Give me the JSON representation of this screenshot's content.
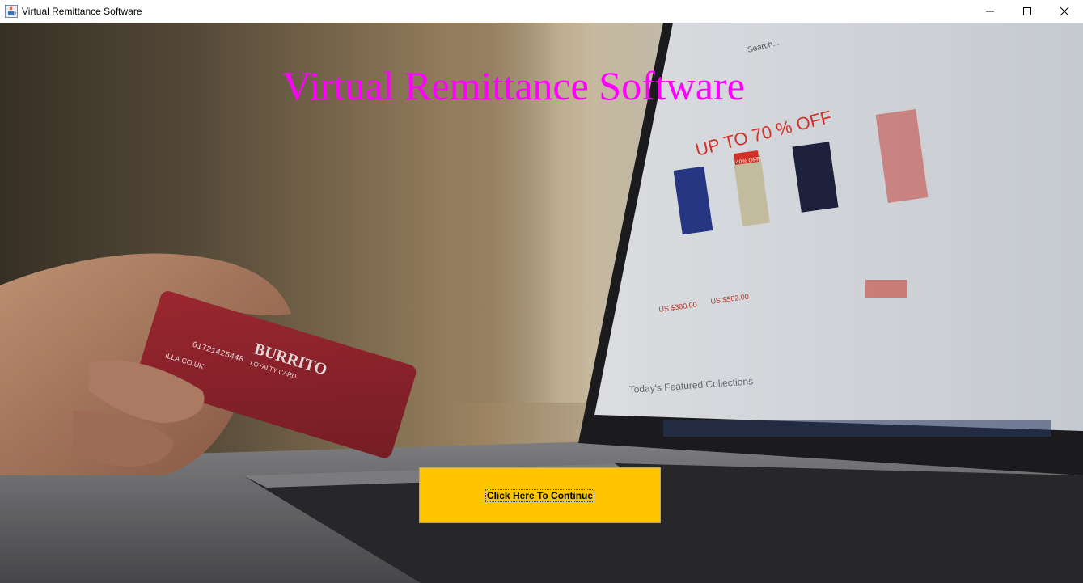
{
  "window": {
    "title": "Virtual Remittance Software",
    "icon": "java-coffee-cup-icon",
    "controls": [
      "minimize-icon",
      "maximize-icon",
      "close-icon"
    ]
  },
  "main": {
    "heading": "Virtual Remittance Software",
    "heading_color": "#ff00ff",
    "continue_button": {
      "label": "Click Here To Continue",
      "color": "#ffc600"
    }
  },
  "background": {
    "card_text": "BURRITO",
    "card_subtitle": "LOYALTY CARD",
    "card_number": "61721425448",
    "card_site": "ILLA.CO.UK",
    "screen_banner": "UP TO 70 % OFF",
    "screen_badge": "40% OFF",
    "screen_search": "Search...",
    "screen_prices": [
      "US $380.00",
      "US $562.00"
    ],
    "screen_collections": "Today's Featured Collections"
  }
}
